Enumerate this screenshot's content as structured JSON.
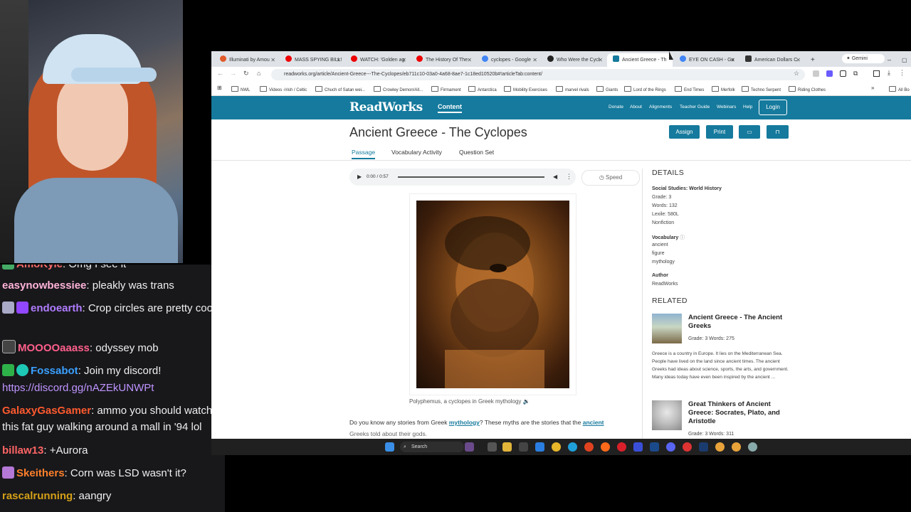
{
  "chat": {
    "messages": [
      {
        "user": "AmoKyle",
        "text": ": Omg I see it",
        "color": "#ff6a6a"
      },
      {
        "user": "easynowbessiee",
        "text": ": pleakly was trans",
        "color": "#ffb3d9"
      },
      {
        "user": "endoearth",
        "text": ": Crop circles are pretty cool.",
        "color": "#b07cff"
      },
      {
        "user": "MOOOOaaass",
        "text": ": odyssey mob",
        "color": "#ff5f8a"
      },
      {
        "user": "Fossabot",
        "text": ": Join my discord!",
        "color": "#3aa0ff"
      },
      {
        "user": "",
        "text": "https://discord.gg/nAZEkUNWPt",
        "color": "#bf94ff"
      },
      {
        "user": "GalaxyGasGamer",
        "text": ": ammo you should watch this fat guy walking around a mall in '94 lol",
        "color": "#ff5a2e"
      },
      {
        "user": "billaw13",
        "text": ": +Aurora",
        "color": "#ff6464"
      },
      {
        "user": "Skeithers",
        "text": ": Corn was LSD wasn't it?",
        "color": "#ff7f2a"
      },
      {
        "user": "rascalrunning",
        "text": ": aangry",
        "color": "#d4a017"
      }
    ]
  },
  "browser": {
    "tabs": [
      {
        "label": "Illuminati by Amou"
      },
      {
        "label": "MASS SPYING BILL!"
      },
      {
        "label": "WATCH: 'Golden ag"
      },
      {
        "label": "The History Of The"
      },
      {
        "label": "cyclopes - Google"
      },
      {
        "label": "Who Were the Cycl"
      },
      {
        "label": "Ancient Greece - Th"
      },
      {
        "label": "EYE ON CASH - Go"
      },
      {
        "label": "American Dollars C"
      }
    ],
    "gemini": "Gemini",
    "url": "readworks.org/article/Ancient-Greece---The-Cyclopes/eb711c10-03a0-4a68-8ae7-1c18ed10520b#!articleTab:content/",
    "bookmarks": [
      "NWL",
      "Videos -Irish / Celtic",
      "Chuch of Satan wei...",
      "Crowley Demon/All...",
      "Firmament",
      "Antarctica",
      "Mobility Exercises",
      "marvel rivals",
      "Giants",
      "Lord of the Rings",
      "End Times",
      "Merfolk",
      "Techno Serpent",
      "Riding Clothes"
    ],
    "all_bookmarks": "All Bo"
  },
  "site": {
    "logo": "ReadWorks",
    "content": "Content",
    "nav": [
      "Donate",
      "About",
      "Alignments",
      "Teacher Guide",
      "Webinars",
      "Help"
    ],
    "login": "Login",
    "title": "Ancient Greece - The Cyclopes",
    "assign": "Assign",
    "print": "Print",
    "subtabs": [
      "Passage",
      "Vocabulary Activity",
      "Question Set"
    ],
    "audio_time": "0:00 / 0:57",
    "speed": "Speed",
    "caption": "Polyphemus, a cyclopes in Greek mythology",
    "para_1": "Do you know any stories from Greek ",
    "kw_1": "mythology",
    "para_2": "? These myths are the stories that the ",
    "kw_2": "ancient",
    "para_3": "Greeks told about their gods.",
    "details_h": "DETAILS",
    "details": {
      "subject": "Social Studies: World History",
      "grade": "Grade: 3",
      "words": "Words: 132",
      "lexile": "Lexile: 580L",
      "type": "Nonfiction",
      "vocab_h": "Vocabulary",
      "vocab": [
        "ancient",
        "figure",
        "mythology"
      ],
      "author_h": "Author",
      "author": "ReadWorks"
    },
    "related_h": "RELATED",
    "related": [
      {
        "title": "Ancient Greece - The Ancient Greeks",
        "meta": "Grade: 3 Words: 275",
        "desc": "Greece is a country in Europe. It lies on the Mediterranean Sea. People have lived on the land since ancient times. The ancient Greeks had ideas about science, sports, the arts, and government. Many ideas today have even been inspired by the ancient ..."
      },
      {
        "title": "Great Thinkers of Ancient Greece: Socrates, Plato, and Aristotle",
        "meta": "Grade: 3 Words: 311"
      }
    ]
  },
  "taskbar": {
    "search": "Search"
  }
}
